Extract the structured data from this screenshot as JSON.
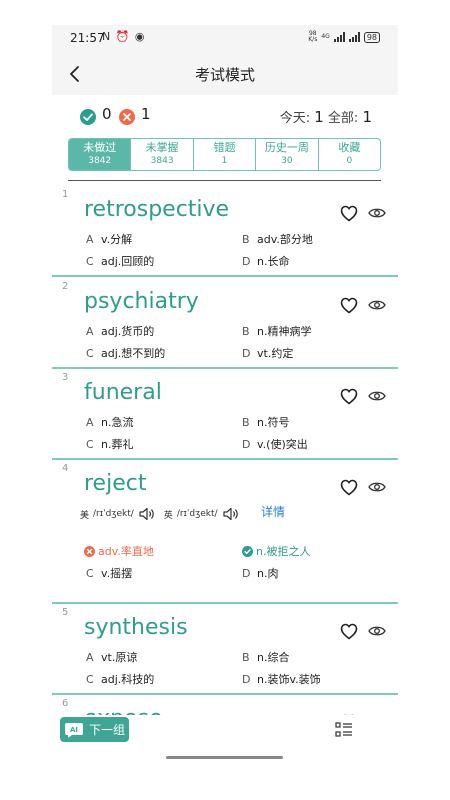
{
  "status_bar": {
    "time": "21:57",
    "icons": "N ⏰ ◉",
    "net_rate": "98",
    "net_unit": "K/s",
    "net_type": "4G",
    "battery": "98"
  },
  "header": {
    "title": "考试模式"
  },
  "stats": {
    "correct": "0",
    "wrong": "1",
    "today_label": "今天:",
    "today_value": "1",
    "total_label": "全部:",
    "total_value": "1"
  },
  "tabs": [
    {
      "label": "未做过",
      "count": "3842"
    },
    {
      "label": "未掌握",
      "count": "3843"
    },
    {
      "label": "错题",
      "count": "1"
    },
    {
      "label": "历史一周",
      "count": "30"
    },
    {
      "label": "收藏",
      "count": "0"
    }
  ],
  "words": [
    {
      "index": "1",
      "word": "retrospective",
      "options": [
        {
          "letter": "A",
          "text": "v.分解"
        },
        {
          "letter": "B",
          "text": "adv.部分地"
        },
        {
          "letter": "C",
          "text": "adj.回顾的"
        },
        {
          "letter": "D",
          "text": "n.长命"
        }
      ]
    },
    {
      "index": "2",
      "word": "psychiatry",
      "options": [
        {
          "letter": "A",
          "text": "adj.货币的"
        },
        {
          "letter": "B",
          "text": "n.精神病学"
        },
        {
          "letter": "C",
          "text": "adj.想不到的"
        },
        {
          "letter": "D",
          "text": "vt.约定"
        }
      ]
    },
    {
      "index": "3",
      "word": "funeral",
      "options": [
        {
          "letter": "A",
          "text": "n.急流"
        },
        {
          "letter": "B",
          "text": "n.符号"
        },
        {
          "letter": "C",
          "text": "n.葬礼"
        },
        {
          "letter": "D",
          "text": "v.(使)突出"
        }
      ]
    },
    {
      "index": "4",
      "word": "reject",
      "phonetic_us_label": "美",
      "phonetic_us": "/rɪˈdʒekt/",
      "phonetic_uk_label": "英",
      "phonetic_uk": "/rɪˈdʒekt/",
      "detail": "详情",
      "options": [
        {
          "letter": "",
          "text": "adv.率直地"
        },
        {
          "letter": "",
          "text": "n.被拒之人"
        },
        {
          "letter": "C",
          "text": "v.摇摆"
        },
        {
          "letter": "D",
          "text": "n.肉"
        }
      ]
    },
    {
      "index": "5",
      "word": "synthesis",
      "options": [
        {
          "letter": "A",
          "text": "vt.原谅"
        },
        {
          "letter": "B",
          "text": "n.综合"
        },
        {
          "letter": "C",
          "text": "adj.科技的"
        },
        {
          "letter": "D",
          "text": "n.装饰v.装饰"
        }
      ]
    },
    {
      "index": "6",
      "word": "expose"
    }
  ],
  "bottom": {
    "next_label": "下一组",
    "ai_label": "AI"
  },
  "colors": {
    "accent": "#2e9d8c",
    "wrong": "#ee6a4b",
    "link": "#2a7fd4"
  }
}
